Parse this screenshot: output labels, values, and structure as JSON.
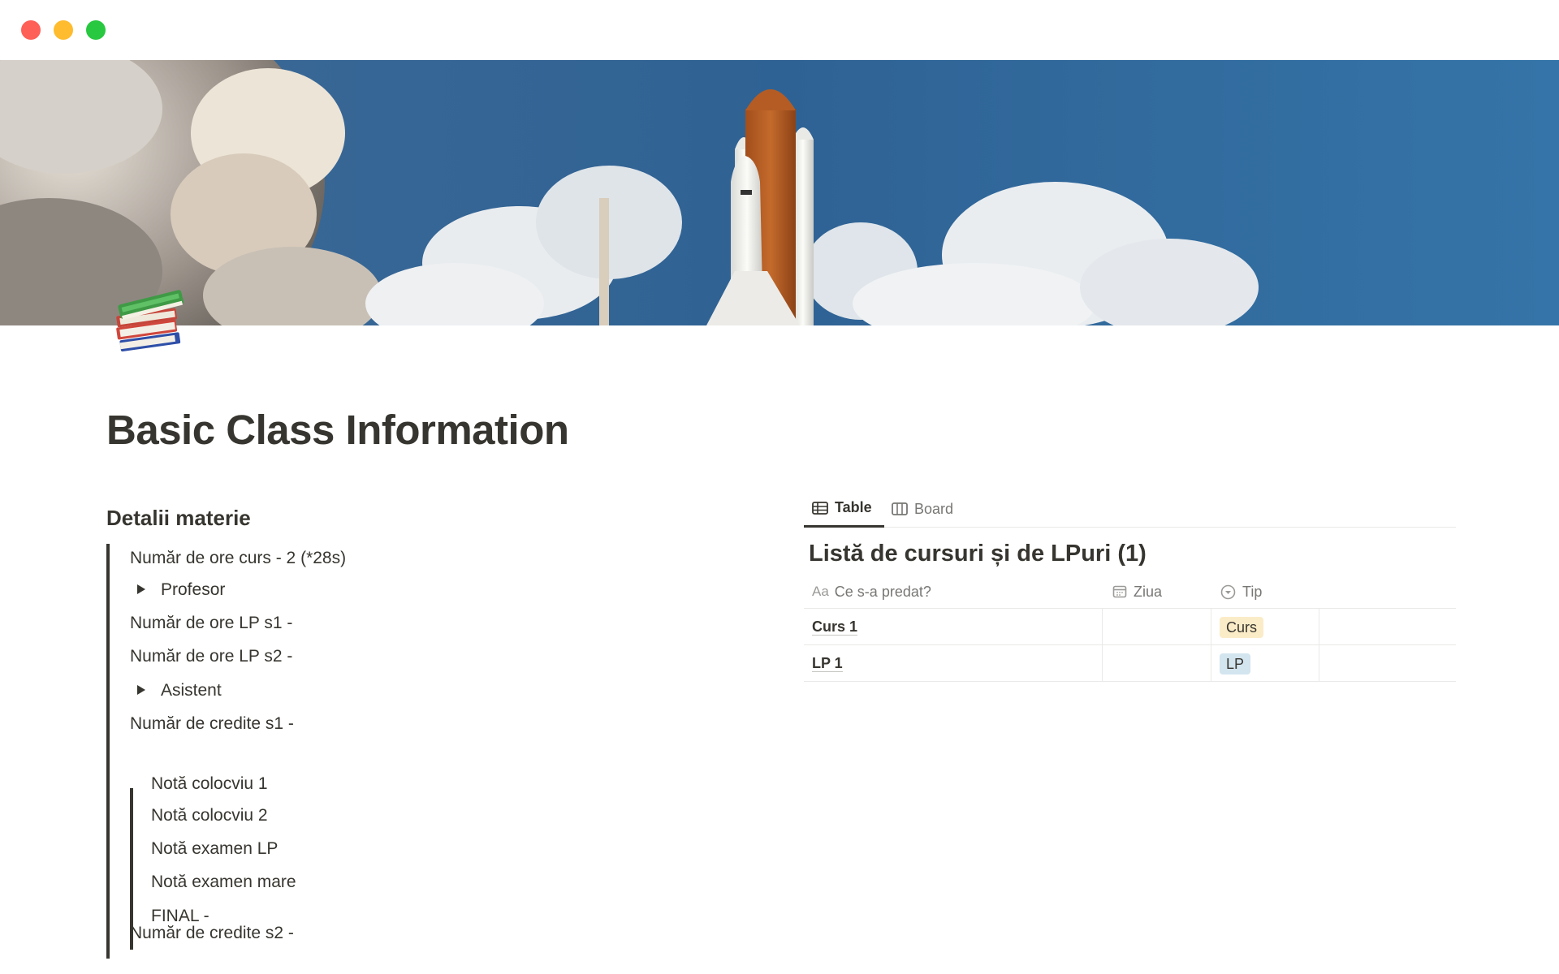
{
  "window": {
    "controls": [
      "close",
      "minimize",
      "zoom"
    ]
  },
  "page": {
    "icon": "books-emoji-icon",
    "title": "Basic Class Information"
  },
  "details": {
    "heading": "Detalii materie",
    "line_ore_curs": "Număr de ore curs - 2 (*28s)",
    "toggle_profesor": "Profesor",
    "line_ore_lp_s1": "Număr de ore LP s1 -",
    "line_ore_lp_s2": "Număr de ore LP s2 -",
    "toggle_asistent": "Asistent",
    "line_credite_s1": "Număr de credite s1 -",
    "grades": {
      "colocviu1": "Notă colocviu 1",
      "colocviu2": "Notă colocviu 2",
      "examen_lp": "Notă examen LP",
      "examen_mare": "Notă examen mare",
      "final": "FINAL -"
    },
    "line_credite_s2": "Număr de credite s2 -"
  },
  "database": {
    "tabs": [
      {
        "label": "Table",
        "icon": "table-icon",
        "active": true
      },
      {
        "label": "Board",
        "icon": "board-icon",
        "active": false
      }
    ],
    "title": "Listă de cursuri și de LPuri (1)",
    "columns": [
      {
        "prefix": "Aa",
        "label": "Ce s-a predat?",
        "icon": "text-property-icon"
      },
      {
        "label": "Ziua",
        "icon": "calendar-icon"
      },
      {
        "label": "Tip",
        "icon": "select-property-icon"
      }
    ],
    "rows": [
      {
        "name": "Curs 1",
        "ziua": "",
        "tip": "Curs",
        "tip_color": "#fbecc8"
      },
      {
        "name": "LP 1",
        "ziua": "",
        "tip": "LP",
        "tip_color": "#d3e5ef"
      }
    ]
  }
}
